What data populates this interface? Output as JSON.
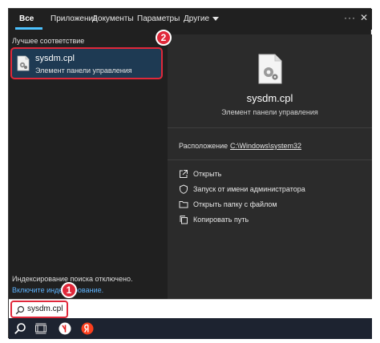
{
  "tabs": [
    {
      "label": "Все",
      "active": true
    },
    {
      "label": "Приложения"
    },
    {
      "label": "Документы"
    },
    {
      "label": "Параметры"
    },
    {
      "label": "Другие"
    }
  ],
  "header_icons": {
    "more": "more-icon",
    "close": "close-icon"
  },
  "left": {
    "section_title": "Лучшее соответствие",
    "result": {
      "name": "sysdm.cpl",
      "subtitle": "Элемент панели управления"
    },
    "indexing_notice": "Индексирование поиска отключено.",
    "indexing_link": "Включите индексирование."
  },
  "detail": {
    "name": "sysdm.cpl",
    "subtitle": "Элемент панели управления",
    "location_label": "Расположение",
    "location_path": "C:\\Windows\\system32",
    "actions": [
      {
        "label": "Открыть",
        "icon": "open-icon"
      },
      {
        "label": "Запуск от имени администратора",
        "icon": "run-as-admin-icon"
      },
      {
        "label": "Открыть папку с файлом",
        "icon": "open-folder-icon"
      },
      {
        "label": "Копировать путь",
        "icon": "copy-path-icon"
      }
    ]
  },
  "search": {
    "value": "sysdm.cpl"
  },
  "badges": {
    "one": "1",
    "two": "2"
  },
  "colors": {
    "accent": "#4cc2ff",
    "highlight": "#e0283a",
    "selected_bg": "#1e3a53"
  }
}
